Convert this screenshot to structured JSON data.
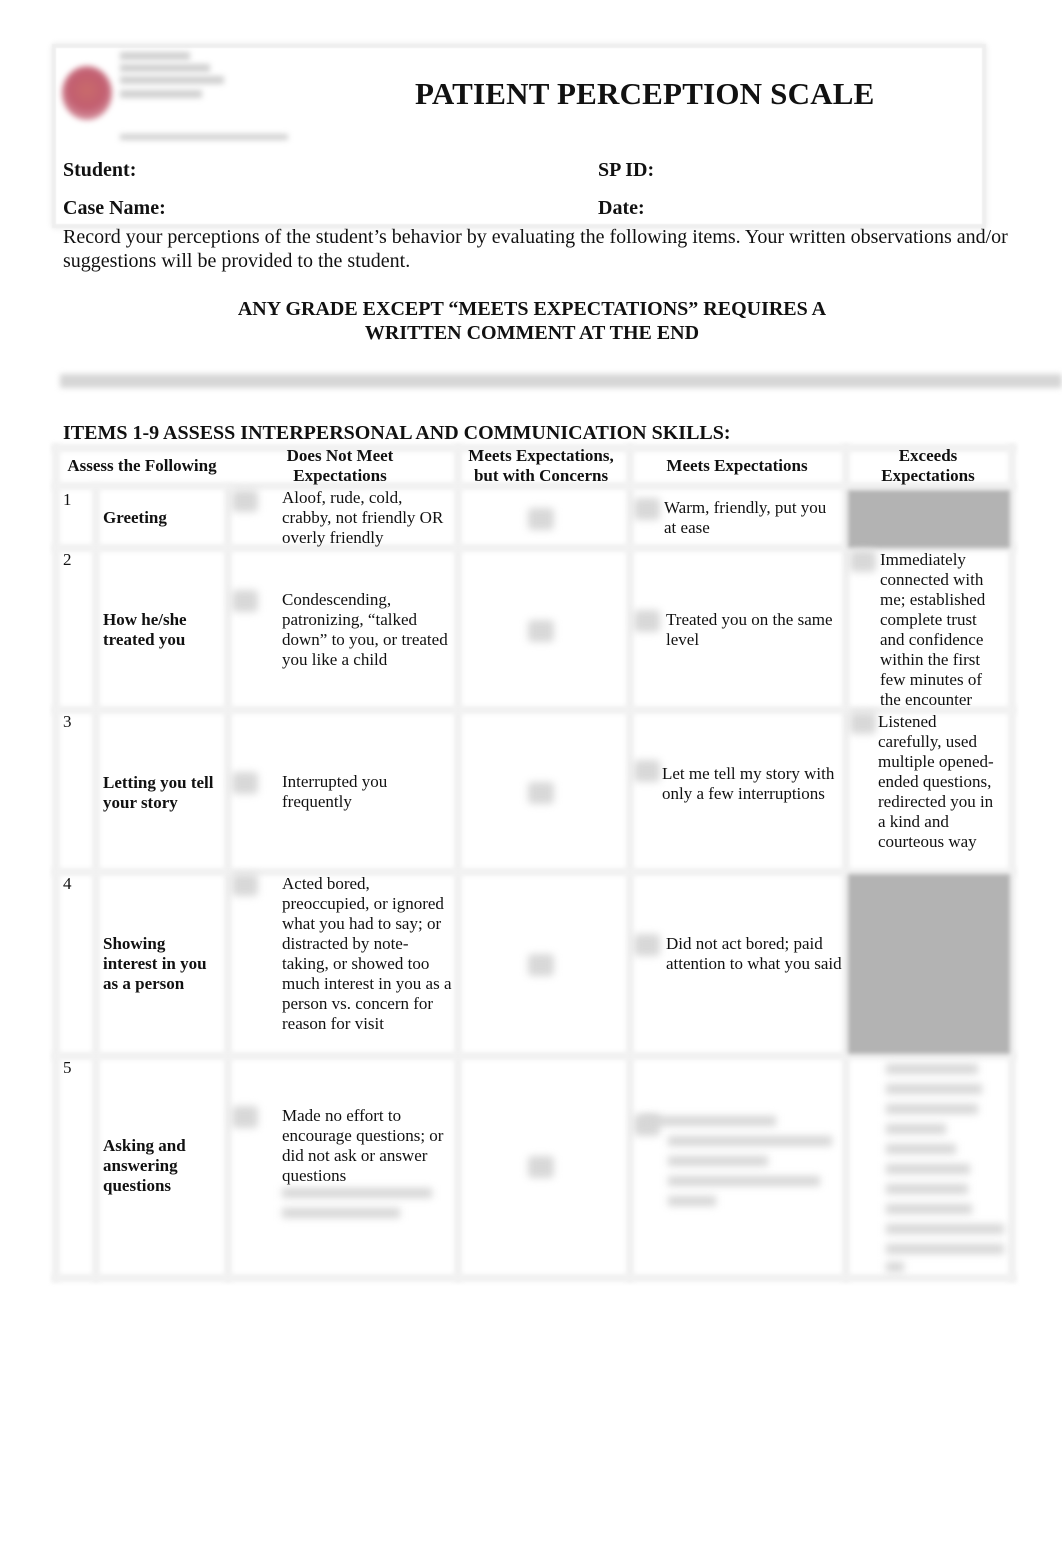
{
  "document": {
    "title": "PATIENT PERCEPTION SCALE",
    "fields": {
      "student": "Student:",
      "sp_id": "SP ID:",
      "case_name": "Case Name:",
      "date": "Date:"
    },
    "intro": "Record your perceptions of the student’s behavior by evaluating the following items. Your written observations and/or suggestions will be provided to the student.",
    "notice_line1": "ANY GRADE EXCEPT  “MEETS EXPECTATIONS” REQUIRES A",
    "notice_line2": "WRITTEN COMMENT AT THE END",
    "section_heading": "ITEMS 1-9 ASSESS INTERPERSONAL AND COMMUNICATION SKILLS:"
  },
  "table": {
    "headers": {
      "assess": "Assess the Following",
      "does_not_meet_1": "Does Not Meet",
      "does_not_meet_2": "Expectations",
      "concerns_1": "Meets Expectations,",
      "concerns_2": "but with Concerns",
      "meets": "Meets Expectations",
      "exceeds_1": "Exceeds",
      "exceeds_2": "Expectations"
    },
    "rows": [
      {
        "number": "1",
        "label": "Greeting",
        "does_not_meet": "Aloof, rude, cold, crabby, not friendly OR overly friendly",
        "meets": "Warm, friendly, put you at ease",
        "exceeds": ""
      },
      {
        "number": "2",
        "label": "How he/she treated you",
        "does_not_meet": "Condescending, patronizing, “talked down” to you, or treated you like a child",
        "meets": "Treated you on the same level",
        "exceeds": "Immediately connected with me; established complete trust and confidence within the first few minutes of the encounter"
      },
      {
        "number": "3",
        "label": "Letting you tell your story",
        "does_not_meet": "Interrupted you frequently",
        "meets": "Let me tell my story with only a few interruptions",
        "exceeds": "Listened carefully, used multiple opened-ended questions, redirected you in a kind and courteous way"
      },
      {
        "number": "4",
        "label": "Showing interest in you as a person",
        "does_not_meet": "Acted bored, preoccupied, or ignored what you had to say; or distracted by note-taking, or showed too much interest in you as a person vs. concern for reason for visit",
        "meets": "Did not act bored; paid attention to what you said",
        "exceeds": ""
      },
      {
        "number": "5",
        "label": "Asking and answering questions",
        "does_not_meet": "Made no effort to encourage questions; or did not ask or answer questions",
        "meets": "",
        "exceeds": ""
      }
    ]
  }
}
